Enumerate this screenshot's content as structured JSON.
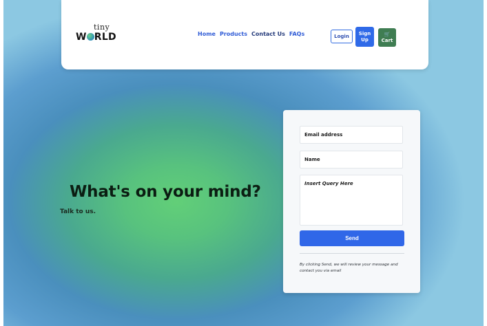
{
  "brand": {
    "logo_top": "tiny",
    "logo_bottom_prefix": "W",
    "logo_bottom_suffix": "RLD"
  },
  "nav": {
    "links": [
      "Home",
      "Products",
      "Contact Us",
      "FAQs"
    ],
    "login": "Login",
    "signup_line1": "Sign",
    "signup_line2": "Up",
    "cart": "Cart"
  },
  "hero": {
    "title": "What's on your mind?",
    "subtitle": "Talk to us."
  },
  "form": {
    "email_placeholder": "Email address",
    "name_placeholder": "Name",
    "query_placeholder": "Insert Query Here",
    "send_label": "Send",
    "disclaimer": "By clicking Send, we will review your message and contact you via email"
  },
  "colors": {
    "accent": "#3067e8",
    "cart": "#3f7d52",
    "hero_green": "#62cf78",
    "sky": "#8cc8e2"
  },
  "icons": {
    "cart": "cart-icon",
    "logo_o": "globe-icon"
  }
}
